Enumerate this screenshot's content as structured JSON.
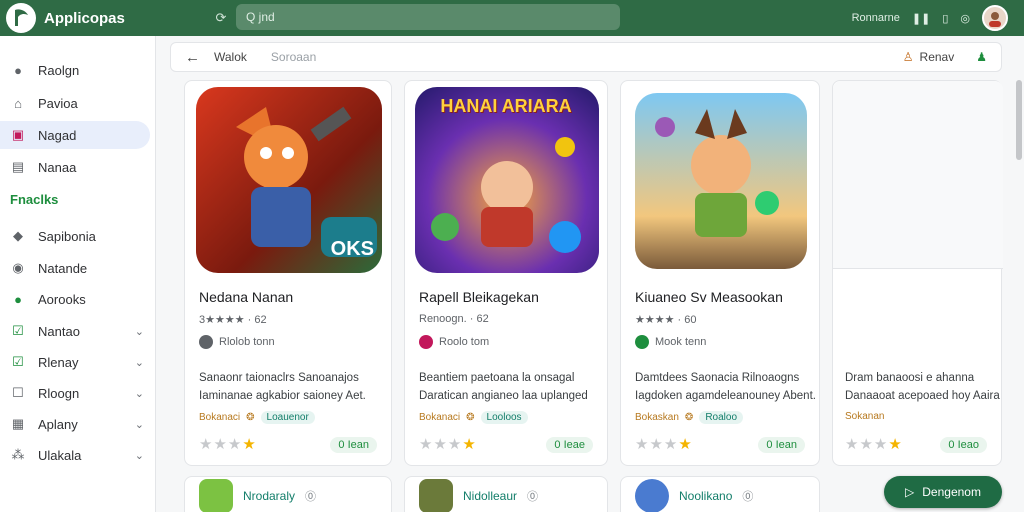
{
  "app": {
    "title": "Applicopas"
  },
  "search": {
    "placeholder": "Q jnd"
  },
  "top_right": {
    "label": "Ronnarne"
  },
  "sidebar": {
    "items_top": [
      {
        "label": "Raolgn",
        "icon": "user-icon"
      },
      {
        "label": "Pavioa",
        "icon": "home-icon"
      },
      {
        "label": "Nagad",
        "icon": "monitor-icon"
      },
      {
        "label": "Nanaa",
        "icon": "briefcase-icon"
      }
    ],
    "section": "Fnaclks",
    "items_bottom": [
      {
        "label": "Sapibonia",
        "icon": "tag-icon",
        "chevron": false
      },
      {
        "label": "Natande",
        "icon": "circle-icon",
        "chevron": false
      },
      {
        "label": "Aorooks",
        "icon": "circle-check-icon",
        "chevron": false
      },
      {
        "label": "Nantao",
        "icon": "checkbox-icon",
        "chevron": true
      },
      {
        "label": "Rlenay",
        "icon": "checkbox-checked-icon",
        "chevron": true
      },
      {
        "label": "Rloogn",
        "icon": "square-icon",
        "chevron": true
      },
      {
        "label": "Aplany",
        "icon": "grid-icon",
        "chevron": true
      },
      {
        "label": "Ulakala",
        "icon": "nodes-icon",
        "chevron": true
      }
    ]
  },
  "toolbar": {
    "back_label": "Walok",
    "sub_label": "Soroaan",
    "right_label": "Renav"
  },
  "cards": [
    {
      "title": "Nedana Nanan",
      "rating_text": "3★★★★ · 62",
      "dev": "Rlolob tonn",
      "desc1": "Sanaonr taionaclrs Sanoanajos",
      "desc2": "Iaminanae agkabior saioney Aet.",
      "tag1": "Bokanaci",
      "tag2": "Loauenor",
      "stars_on": 1,
      "price": "0 Iean",
      "art_badge": "OKS"
    },
    {
      "title": "Rapell Bleikagekan",
      "rating_text": "Renoogn. · 62",
      "dev": "Roolo tom",
      "desc1": "Beantiem paetoana la onsagal",
      "desc2": "Daratican angianeo laa uplanged",
      "tag1": "Bokanaci",
      "tag2": "Looloos",
      "stars_on": 1,
      "price": "0 Ieae",
      "art_badge": "HANAI ARIARA"
    },
    {
      "title": "Kiuaneo Sv Measookan",
      "rating_text": "★★★★ · 60",
      "dev": "Mook tenn",
      "desc1": "Damtdees Saonacia Rilnoaogns",
      "desc2": "Iagdoken agamdeleanouney Abent.",
      "tag1": "Bokaskan",
      "tag2": "Roaloo",
      "stars_on": 1,
      "price": "0 Iean",
      "art_badge": ""
    },
    {
      "title": "",
      "rating_text": "",
      "dev": "",
      "desc1": "Dram banaoosi e ahanna",
      "desc2": "Danaaoat acepoaed hoy Aaira",
      "tag1": "Sokanan",
      "tag2": "",
      "stars_on": 1,
      "price": "0 Ieao",
      "art_badge": ""
    }
  ],
  "mini": [
    {
      "label": "Nrodaraly"
    },
    {
      "label": "Nidolleaur"
    },
    {
      "label": "Noolikano"
    }
  ],
  "fab": {
    "label": "Dengenom"
  }
}
